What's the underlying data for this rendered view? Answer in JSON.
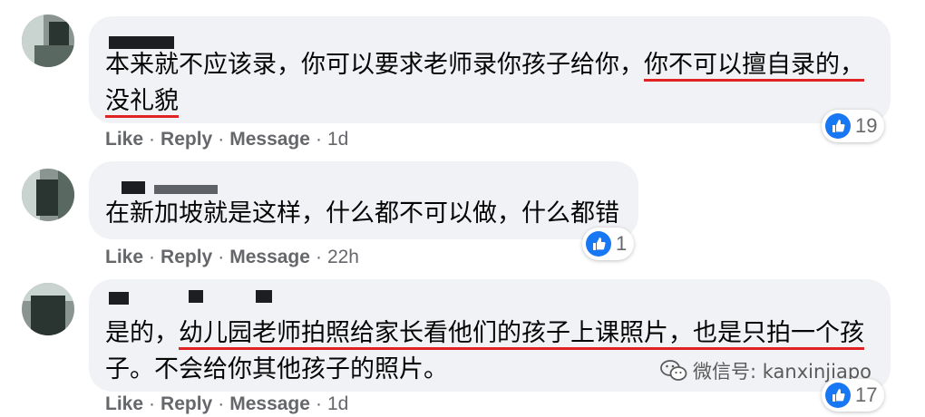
{
  "comments": [
    {
      "text_lines": [
        {
          "plain": "本来就不应该录，你可以要求老师录你孩子给你，",
          "underlined": "你不可以擅自录的，"
        },
        {
          "plain": "",
          "underlined": "没礼貌"
        }
      ],
      "reaction_count": "19",
      "actions": {
        "like": "Like",
        "reply": "Reply",
        "message": "Message",
        "time": "1d"
      }
    },
    {
      "text_lines": [
        {
          "plain": "在新加坡就是这样，什么都不可以做，什么都错",
          "underlined": ""
        }
      ],
      "reaction_count": "1",
      "actions": {
        "like": "Like",
        "reply": "Reply",
        "message": "Message",
        "time": "22h"
      }
    },
    {
      "text_lines": [
        {
          "plain": "是的，",
          "underlined": "幼儿园老师拍照给家长看他们的孩子上课照片，",
          "tail": "也是只拍一个孩"
        },
        {
          "plain": "子。不会给你其他孩子的照片。",
          "underlined": ""
        }
      ],
      "reaction_count": "17",
      "actions": {
        "like": "Like",
        "reply": "Reply",
        "message": "Message",
        "time": "1d"
      }
    }
  ],
  "separator": "·",
  "watermark": {
    "label": "微信号: kanxinjiapo",
    "icon": "wechat-icon"
  },
  "colors": {
    "like_blue": "#1877f2",
    "bubble_bg": "#f0f2f5",
    "underline_red": "#e02424",
    "meta_gray": "#65676b"
  }
}
